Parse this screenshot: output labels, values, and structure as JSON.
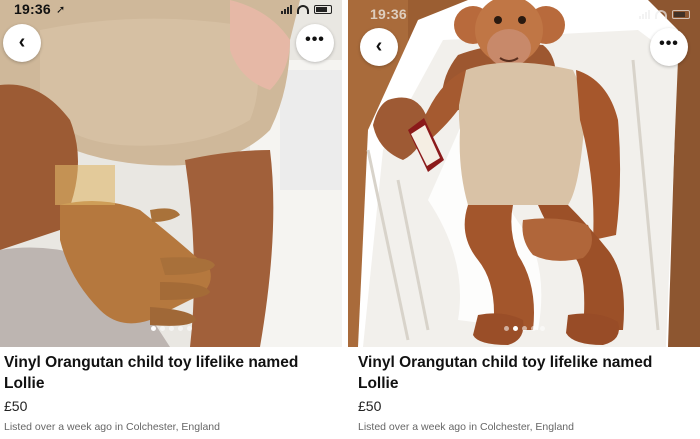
{
  "left_card": {
    "status_time": "19:36",
    "title": "Vinyl Orangutan child toy lifelike named Lollie",
    "price": "£50",
    "listed": "Listed over a week ago in Colchester, England",
    "icons": {
      "back": "chevron-left-icon",
      "more": "more-options-icon",
      "location": "location-arrow-icon"
    },
    "pager": {
      "count": 5,
      "active_index": 0
    }
  },
  "right_card": {
    "status_time": "19:36",
    "title": "Vinyl Orangutan child toy lifelike named Lollie",
    "price": "£50",
    "listed": "Listed over a week ago in Colchester, England",
    "icons": {
      "back": "chevron-left-icon",
      "more": "more-options-icon",
      "location": "location-arrow-icon"
    },
    "pager": {
      "count": 5,
      "active_index": 1
    }
  },
  "controls": {
    "back_glyph": "‹",
    "more_glyph": "•••",
    "location_glyph": "➚"
  },
  "colors": {
    "fur": "#a0522d",
    "cloth_body": "#d9c2a6",
    "box_inside": "#f2f0ec",
    "floor_wood": "#a86a3a"
  }
}
